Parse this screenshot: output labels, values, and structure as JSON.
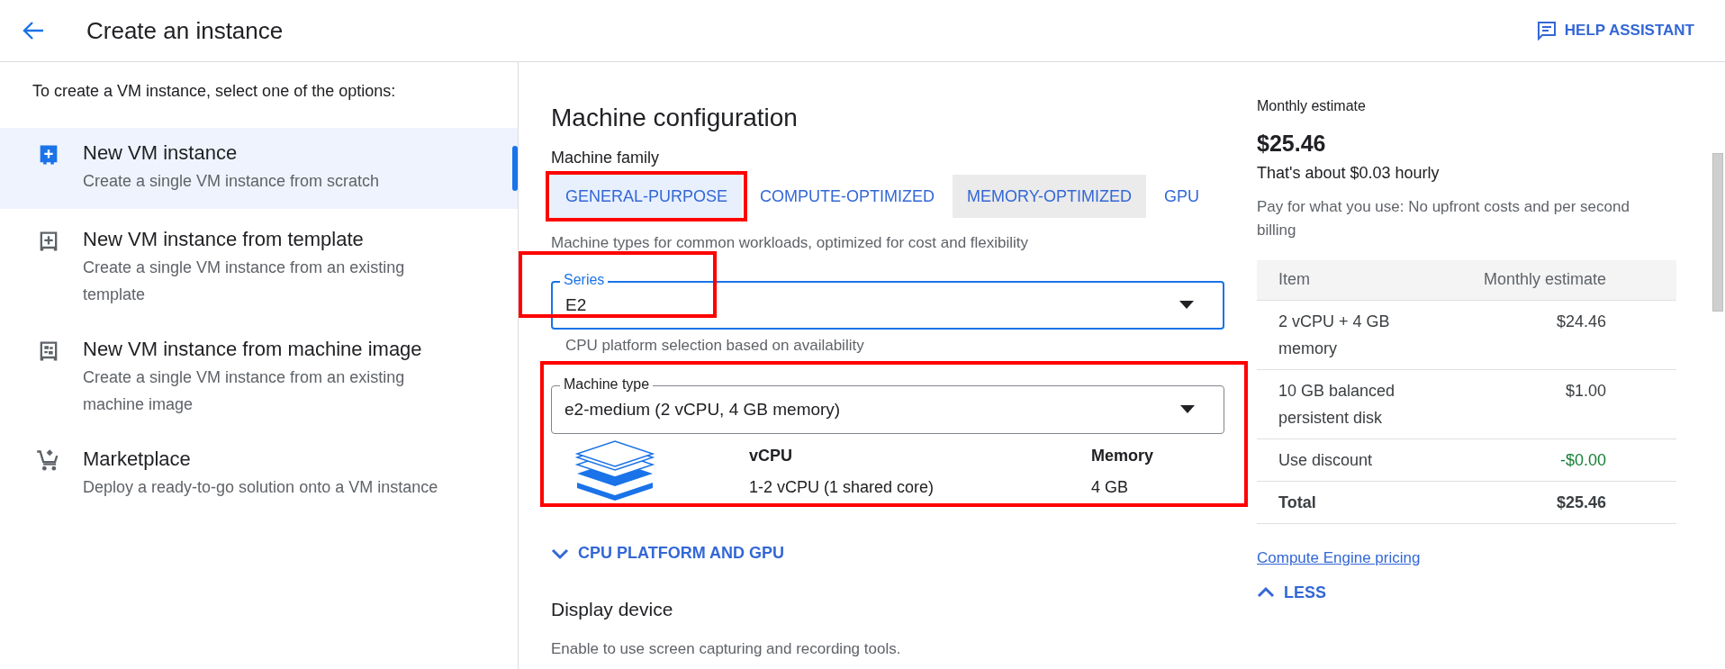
{
  "header": {
    "title": "Create an instance",
    "help_button": "HELP ASSISTANT"
  },
  "sidebar": {
    "intro": "To create a VM instance, select one of the options:",
    "items": [
      {
        "kind": "new",
        "title": "New VM instance",
        "description": "Create a single VM instance from scratch",
        "selected": true
      },
      {
        "kind": "template",
        "title": "New VM instance from template",
        "description": "Create a single VM instance from an existing template",
        "selected": false
      },
      {
        "kind": "image",
        "title": "New VM instance from machine image",
        "description": "Create a single VM instance from an existing machine image",
        "selected": false
      },
      {
        "kind": "marketplace",
        "title": "Marketplace",
        "description": "Deploy a ready-to-go solution onto a VM instance",
        "selected": false
      }
    ]
  },
  "machine_configuration": {
    "title": "Machine configuration",
    "family_label": "Machine family",
    "tabs": [
      {
        "label": "GENERAL-PURPOSE",
        "selected": true,
        "hovered": false,
        "highlighted": true
      },
      {
        "label": "COMPUTE-OPTIMIZED",
        "selected": false,
        "hovered": false,
        "highlighted": false
      },
      {
        "label": "MEMORY-OPTIMIZED",
        "selected": false,
        "hovered": true,
        "highlighted": false
      },
      {
        "label": "GPU",
        "selected": false,
        "hovered": false,
        "highlighted": false
      }
    ],
    "family_description": "Machine types for common workloads, optimized for cost and flexibility",
    "series": {
      "label": "Series",
      "value": "E2",
      "focused": true,
      "highlighted": true,
      "helper": "CPU platform selection based on availability"
    },
    "machine_type": {
      "label": "Machine type",
      "value": "e2-medium (2 vCPU, 4 GB memory)",
      "focused": false,
      "highlighted": true,
      "specs": [
        {
          "heading": "vCPU",
          "value": "1-2 vCPU (1 shared core)"
        },
        {
          "heading": "Memory",
          "value": "4 GB"
        }
      ]
    },
    "cpu_platform_toggle": {
      "label": "CPU PLATFORM AND GPU",
      "expanded": false
    },
    "display_device": {
      "title": "Display device",
      "description": "Enable to use screen capturing and recording tools."
    }
  },
  "estimate": {
    "title": "Monthly estimate",
    "total": "$25.46",
    "hourly": "That's about $0.03 hourly",
    "note": "Pay for what you use: No upfront costs and per second billing",
    "table": {
      "columns": [
        "Item",
        "Monthly estimate"
      ],
      "rows": [
        {
          "kind": "item",
          "item": "2 vCPU + 4 GB memory",
          "cost": "$24.46"
        },
        {
          "kind": "item",
          "item": "10 GB balanced persistent disk",
          "cost": "$1.00"
        },
        {
          "kind": "discount",
          "item": "Use discount",
          "cost": "-$0.00"
        },
        {
          "kind": "total",
          "item": "Total",
          "cost": "$25.46"
        }
      ]
    },
    "pricing_link": "Compute Engine pricing",
    "less_toggle": {
      "label": "LESS",
      "expanded": true
    }
  }
}
